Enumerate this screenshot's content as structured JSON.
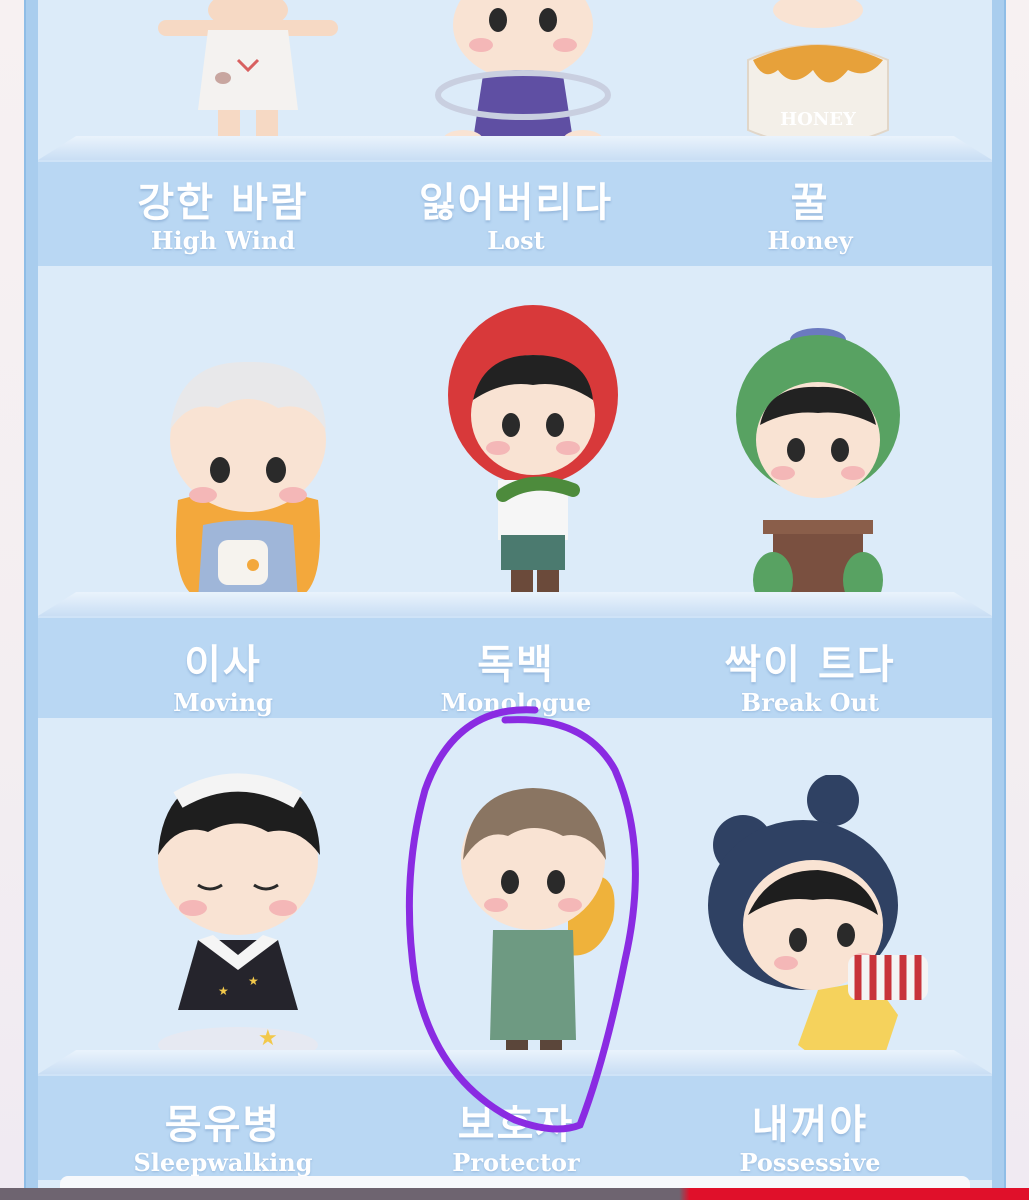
{
  "figures": [
    {
      "kr": "강한 바람",
      "en": "High Wind"
    },
    {
      "kr": "잃어버리다",
      "en": "Lost"
    },
    {
      "kr": "꿀",
      "en": "Honey"
    },
    {
      "kr": "이사",
      "en": "Moving"
    },
    {
      "kr": "독백",
      "en": "Monologue"
    },
    {
      "kr": "싹이 트다",
      "en": "Break Out"
    },
    {
      "kr": "몽유병",
      "en": "Sleepwalking"
    },
    {
      "kr": "보호자",
      "en": "Protector"
    },
    {
      "kr": "내꺼야",
      "en": "Possessive"
    }
  ],
  "colors": {
    "panel": "#a9cdee",
    "background": "#dcebf9",
    "annotation": "#8a2be2"
  }
}
